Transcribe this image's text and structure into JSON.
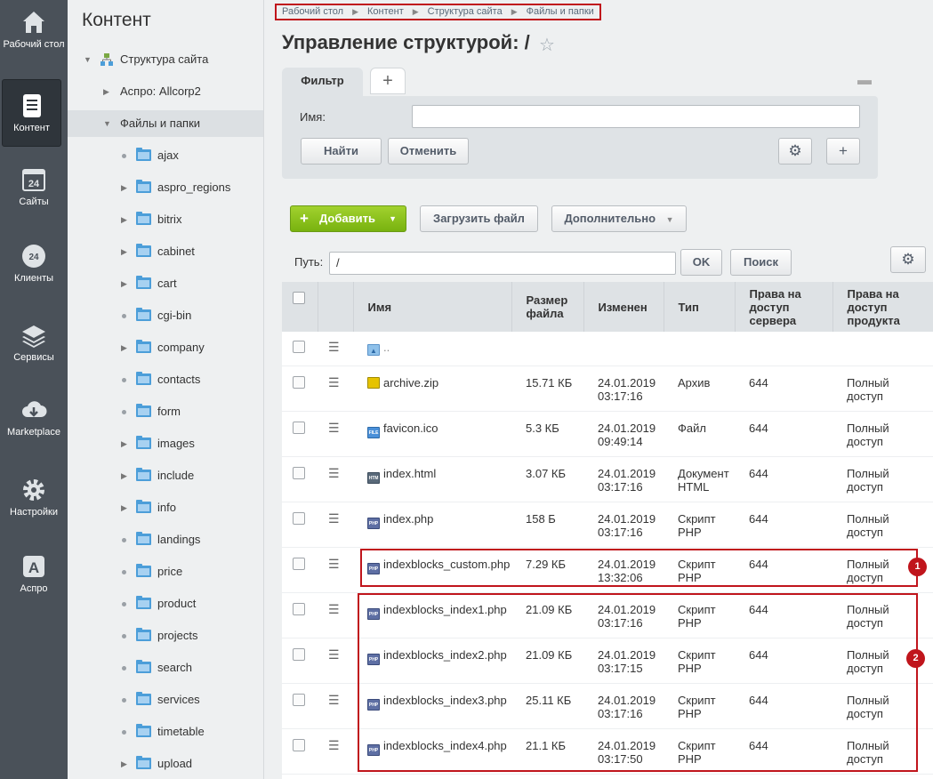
{
  "leftnav": {
    "items": [
      {
        "label": "Рабочий стол",
        "icon": "home-icon"
      },
      {
        "label": "Контент",
        "icon": "document-icon"
      },
      {
        "label": "Сайты",
        "icon": "calendar-24-icon"
      },
      {
        "label": "Клиенты",
        "icon": "cloud-24-icon"
      },
      {
        "label": "Сервисы",
        "icon": "layers-icon"
      },
      {
        "label": "Marketplace",
        "icon": "cloud-download-icon"
      },
      {
        "label": "Настройки",
        "icon": "gear-icon"
      },
      {
        "label": "Аспро",
        "icon": "letter-a-icon"
      }
    ],
    "active_index": 1
  },
  "tree": {
    "title": "Контент",
    "root": "Структура сайта",
    "aspro": "Аспро: Allcorp2",
    "files": "Файлы и папки",
    "folders": [
      "ajax",
      "aspro_regions",
      "bitrix",
      "cabinet",
      "cart",
      "cgi-bin",
      "company",
      "contacts",
      "form",
      "images",
      "include",
      "info",
      "landings",
      "price",
      "product",
      "projects",
      "search",
      "services",
      "timetable",
      "upload"
    ]
  },
  "breadcrumb": [
    "Рабочий стол",
    "Контент",
    "Структура сайта",
    "Файлы и папки"
  ],
  "page": {
    "title": "Управление структурой: /"
  },
  "filter": {
    "tab": "Фильтр",
    "name_label": "Имя:",
    "find_label": "Найти",
    "cancel_label": "Отменить"
  },
  "toolbar": {
    "add_label": "Добавить",
    "upload_label": "Загрузить файл",
    "more_label": "Дополнительно",
    "path_label": "Путь:",
    "path_value": "/",
    "ok_label": "OK",
    "search_label": "Поиск"
  },
  "table": {
    "headers": {
      "name": "Имя",
      "size": "Размер файла",
      "modified": "Изменен",
      "type": "Тип",
      "server_rights": "Права на доступ сервера",
      "product_rights": "Права на доступ продукта"
    },
    "up_label": "..",
    "rows": [
      {
        "name": "archive.zip",
        "icon": "zip-file-icon",
        "size": "15.71 КБ",
        "date": "24.01.2019",
        "time": "03:17:16",
        "type1": "Архив",
        "type2": "",
        "server": "644",
        "product1": "Полный",
        "product2": "доступ"
      },
      {
        "name": "favicon.ico",
        "icon": "ico-file-icon",
        "size": "5.3 КБ",
        "date": "24.01.2019",
        "time": "09:49:14",
        "type1": "Файл",
        "type2": "",
        "server": "644",
        "product1": "Полный",
        "product2": "доступ"
      },
      {
        "name": "index.html",
        "icon": "html-file-icon",
        "size": "3.07 КБ",
        "date": "24.01.2019",
        "time": "03:17:16",
        "type1": "Документ",
        "type2": "HTML",
        "server": "644",
        "product1": "Полный",
        "product2": "доступ"
      },
      {
        "name": "index.php",
        "icon": "php-file-icon",
        "size": "158 Б",
        "date": "24.01.2019",
        "time": "03:17:16",
        "type1": "Скрипт",
        "type2": "PHP",
        "server": "644",
        "product1": "Полный",
        "product2": "доступ"
      },
      {
        "name": "indexblocks_custom.php",
        "icon": "php-file-icon",
        "size": "7.29 КБ",
        "date": "24.01.2019",
        "time": "13:32:06",
        "type1": "Скрипт",
        "type2": "PHP",
        "server": "644",
        "product1": "Полный",
        "product2": "доступ"
      },
      {
        "name": "indexblocks_index1.php",
        "icon": "php-file-icon",
        "size": "21.09 КБ",
        "date": "24.01.2019",
        "time": "03:17:16",
        "type1": "Скрипт",
        "type2": "PHP",
        "server": "644",
        "product1": "Полный",
        "product2": "доступ"
      },
      {
        "name": "indexblocks_index2.php",
        "icon": "php-file-icon",
        "size": "21.09 КБ",
        "date": "24.01.2019",
        "time": "03:17:15",
        "type1": "Скрипт",
        "type2": "PHP",
        "server": "644",
        "product1": "Полный",
        "product2": "доступ"
      },
      {
        "name": "indexblocks_index3.php",
        "icon": "php-file-icon",
        "size": "25.11 КБ",
        "date": "24.01.2019",
        "time": "03:17:16",
        "type1": "Скрипт",
        "type2": "PHP",
        "server": "644",
        "product1": "Полный",
        "product2": "доступ"
      },
      {
        "name": "indexblocks_index4.php",
        "icon": "php-file-icon",
        "size": "21.1 КБ",
        "date": "24.01.2019",
        "time": "03:17:50",
        "type1": "Скрипт",
        "type2": "PHP",
        "server": "644",
        "product1": "Полный",
        "product2": "доступ"
      }
    ]
  },
  "annotations": {
    "badge1": "1",
    "badge2": "2"
  },
  "colors": {
    "accent_green": "#8cc21d",
    "annotation_red": "#c0151c",
    "nav_bg": "#4a5159"
  }
}
